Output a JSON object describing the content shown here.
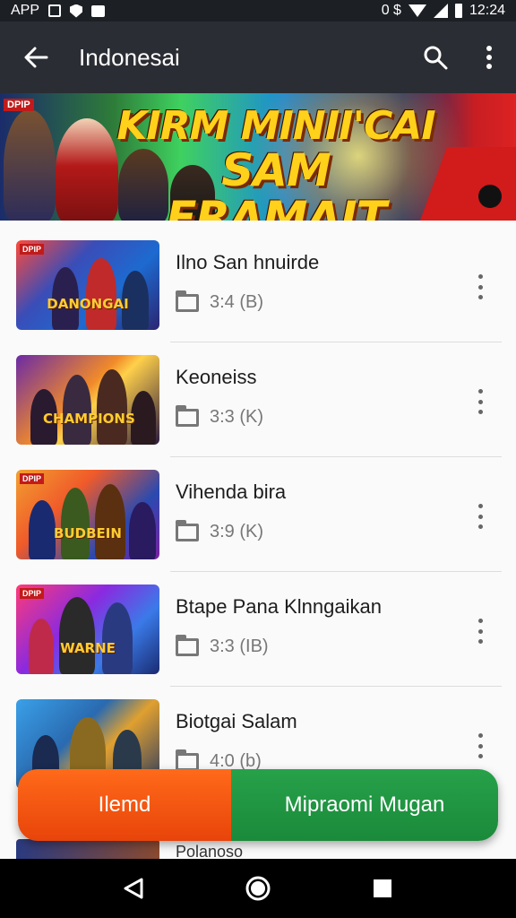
{
  "status_bar": {
    "app_label": "APP",
    "left_icons": [
      "screenshot-icon",
      "shield-icon",
      "bag-icon"
    ],
    "right_text": "0 $",
    "right_icons": [
      "wifi-icon",
      "signal-icon",
      "battery-icon"
    ],
    "time": "12:24"
  },
  "app_bar": {
    "title": "Indonesai",
    "back_icon": "arrow-left-icon",
    "search_icon": "search-icon",
    "menu_icon": "more-vertical-icon"
  },
  "banner": {
    "tag": "DPIP",
    "headline_line1": "KIRM MINII'CAI",
    "headline_line2": "SAM FRAMAIT"
  },
  "items": [
    {
      "name": "Ilno San hnuirde",
      "meta": "3:4 (B)",
      "badge": "DPIP",
      "logo": "DANONGAI"
    },
    {
      "name": "Keoneiss",
      "meta": "3:3 (K)",
      "badge": "",
      "logo": "CHAMPIONS"
    },
    {
      "name": "Vihenda bira",
      "meta": "3:9 (K)",
      "badge": "DPIP",
      "logo": "BUDBEIN"
    },
    {
      "name": "Btape Pana Klnngaikan",
      "meta": "3:3 (IB)",
      "badge": "DPIP",
      "logo": "WARNE"
    },
    {
      "name": "Biotgai Salam",
      "meta": "4:0 (b)",
      "badge": "",
      "logo": ""
    }
  ],
  "peek_item": {
    "name": "Polanoso"
  },
  "cta": {
    "left_label": "Ilemd",
    "right_label": "Mipraomi Mugan"
  },
  "nav_bar": {
    "back": "triangle-back-icon",
    "home": "circle-home-icon",
    "recents": "square-recents-icon"
  },
  "colors": {
    "app_bar": "#2a2d33",
    "status_bar": "#1c1f24",
    "cta_left": "#ff6a1a",
    "cta_right": "#1f9341"
  }
}
